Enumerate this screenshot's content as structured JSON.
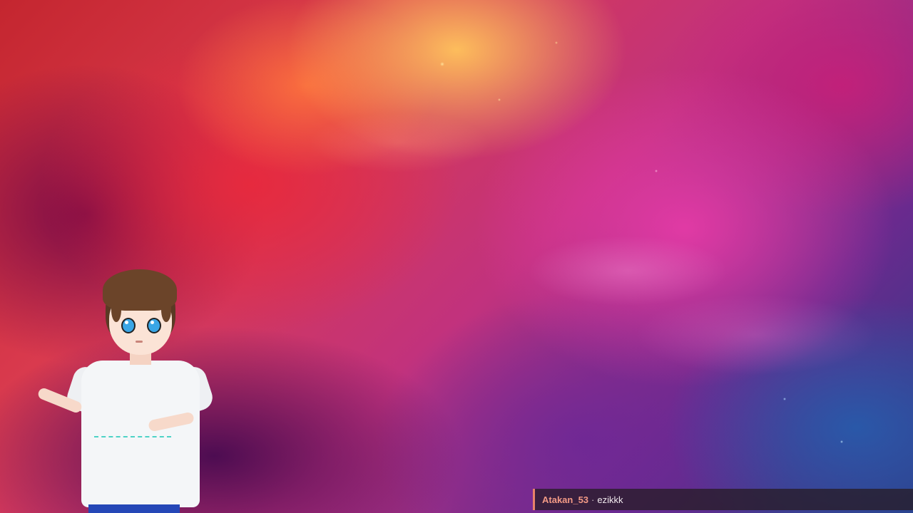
{
  "background": {
    "description_icon": "nebula-background"
  },
  "avatar": {
    "icon": "vtuber-avatar"
  },
  "chat": {
    "username": "Atakan_53",
    "separator": "·",
    "message": "ezikkk",
    "username_color": "#f39a86",
    "accent_color": "#e8826a"
  }
}
